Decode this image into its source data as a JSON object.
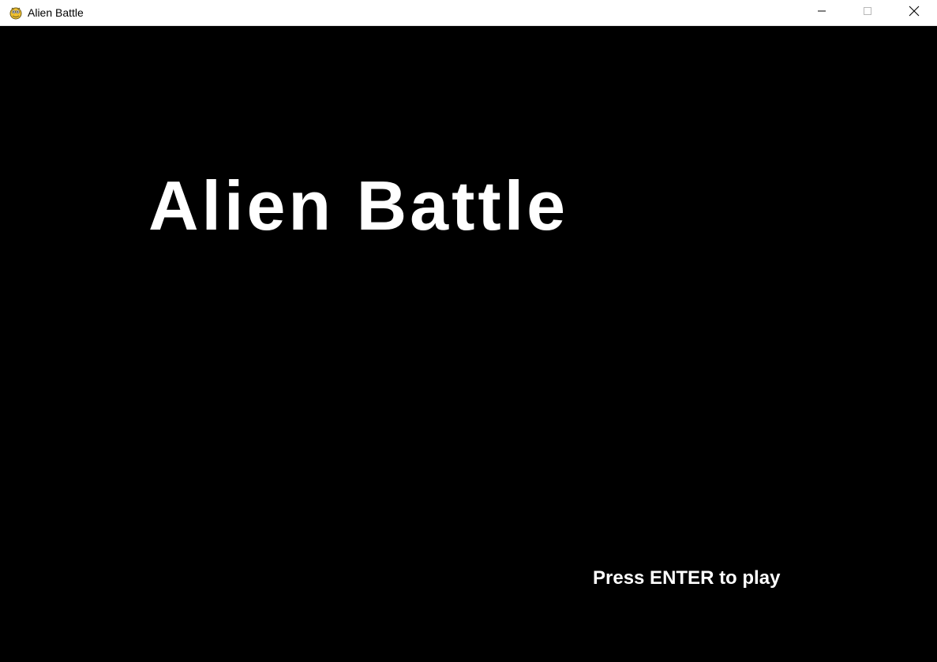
{
  "window": {
    "title": "Alien Battle",
    "icon": "pygame-snake-icon",
    "controls": {
      "minimize_icon": "minimize-icon",
      "maximize_icon": "maximize-icon",
      "close_icon": "close-icon"
    }
  },
  "game": {
    "title": "Alien Battle",
    "prompt": "Press ENTER to play",
    "background_color": "#000000",
    "text_color": "#ffffff"
  }
}
